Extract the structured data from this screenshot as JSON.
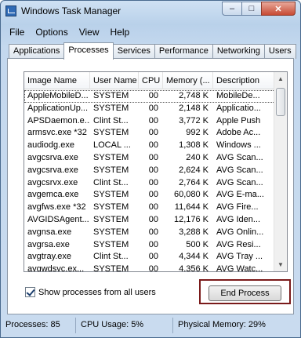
{
  "window": {
    "title": "Windows Task Manager"
  },
  "caption": {
    "minimize": "‒",
    "maximize": "□",
    "close": "✕"
  },
  "menu": [
    "File",
    "Options",
    "View",
    "Help"
  ],
  "tabs": [
    "Applications",
    "Processes",
    "Services",
    "Performance",
    "Networking",
    "Users"
  ],
  "active_tab": "Processes",
  "columns": [
    "Image Name",
    "User Name",
    "CPU",
    "Memory (...",
    "Description"
  ],
  "processes": [
    [
      "AppleMobileD...",
      "SYSTEM",
      "00",
      "2,748 K",
      "MobileDe..."
    ],
    [
      "ApplicationUp...",
      "SYSTEM",
      "00",
      "2,148 K",
      "Applicatio..."
    ],
    [
      "APSDaemon.e...",
      "Clint St...",
      "00",
      "3,772 K",
      "Apple Push"
    ],
    [
      "armsvc.exe *32",
      "SYSTEM",
      "00",
      "992 K",
      "Adobe Ac..."
    ],
    [
      "audiodg.exe",
      "LOCAL ...",
      "00",
      "1,308 K",
      "Windows ..."
    ],
    [
      "avgcsrva.exe",
      "SYSTEM",
      "00",
      "240 K",
      "AVG Scan..."
    ],
    [
      "avgcsrva.exe",
      "SYSTEM",
      "00",
      "2,624 K",
      "AVG Scan..."
    ],
    [
      "avgcsrvx.exe",
      "Clint St...",
      "00",
      "2,764 K",
      "AVG Scan..."
    ],
    [
      "avgemca.exe",
      "SYSTEM",
      "00",
      "60,080 K",
      "AVG E-ma..."
    ],
    [
      "avgfws.exe *32",
      "SYSTEM",
      "00",
      "11,644 K",
      "AVG Fire..."
    ],
    [
      "AVGIDSAgent...",
      "SYSTEM",
      "00",
      "12,176 K",
      "AVG Iden..."
    ],
    [
      "avgnsa.exe",
      "SYSTEM",
      "00",
      "3,288 K",
      "AVG Onlin..."
    ],
    [
      "avgrsa.exe",
      "SYSTEM",
      "00",
      "500 K",
      "AVG Resi..."
    ],
    [
      "avgtray.exe",
      "Clint St...",
      "00",
      "4,344 K",
      "AVG Tray ..."
    ],
    [
      "avgwdsvc.ex...",
      "SYSTEM",
      "00",
      "4,356 K",
      "AVG Watc..."
    ]
  ],
  "show_all_label": "Show processes from all users",
  "show_all_checked": true,
  "end_process_label": "End Process",
  "status": {
    "processes": "Processes: 85",
    "cpu": "CPU Usage: 5%",
    "memory": "Physical Memory: 29%"
  },
  "colors": {
    "highlight_border": "#7a1a1a",
    "title_gradient": "#b9d1ea"
  }
}
